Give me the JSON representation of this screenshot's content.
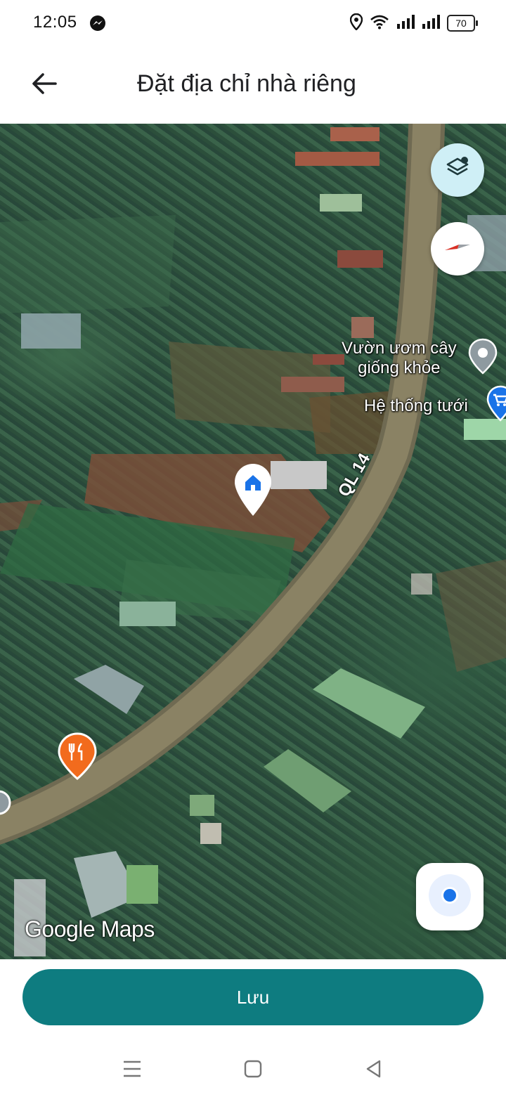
{
  "status_bar": {
    "time": "12:05",
    "battery_level": "70",
    "icons": [
      "messenger-icon",
      "location-icon",
      "wifi-icon",
      "signal-icon",
      "signal-icon",
      "battery-icon"
    ]
  },
  "app_bar": {
    "title": "Đặt địa chỉ nhà riêng",
    "back_icon": "arrow-left-icon"
  },
  "map": {
    "road_label": "QL 14",
    "places": [
      {
        "name_line1": "Vườn ươm cây",
        "name_line2": "giống khỏe",
        "icon": "place-pin-icon"
      },
      {
        "name": "Hệ thống tưới",
        "icon": "shopping-cart-icon"
      }
    ],
    "home_marker_icon": "home-pin-icon",
    "restaurant_marker_icon": "restaurant-pin-icon",
    "watermark": "Google Maps",
    "controls": [
      "layers-icon",
      "compass-icon",
      "my-location-icon"
    ]
  },
  "actions": {
    "save_label": "Lưu"
  },
  "colors": {
    "accent": "#0e7c80",
    "layers_button_bg": "#cfeff6",
    "road": "#8a8264",
    "location_dot": "#1a73e8",
    "restaurant_pin": "#f26b1d",
    "home_pin": "#1a73e8"
  },
  "nav_bar": {
    "icons": [
      "recents-icon",
      "home-square-icon",
      "back-triangle-icon"
    ]
  }
}
